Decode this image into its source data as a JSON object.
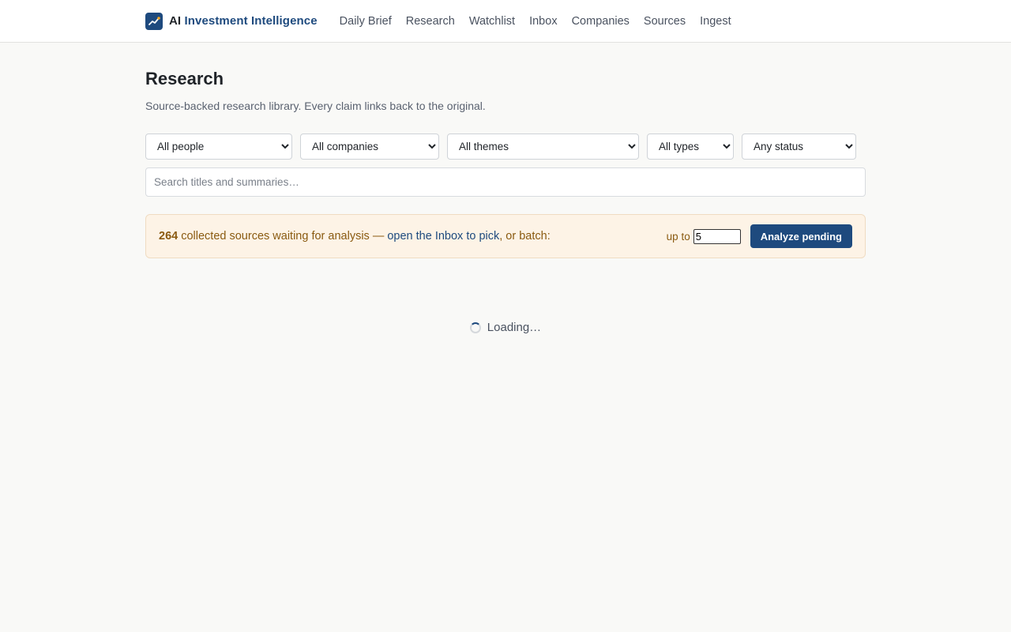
{
  "brand": {
    "prefix": "AI",
    "name": "Investment Intelligence",
    "logo_icon": "trend-chart-icon"
  },
  "nav": {
    "items": [
      {
        "label": "Daily Brief"
      },
      {
        "label": "Research"
      },
      {
        "label": "Watchlist"
      },
      {
        "label": "Inbox"
      },
      {
        "label": "Companies"
      },
      {
        "label": "Sources"
      },
      {
        "label": "Ingest"
      }
    ]
  },
  "page": {
    "title": "Research",
    "subtitle": "Source-backed research library. Every claim links back to the original."
  },
  "filters": {
    "people": "All people",
    "companies": "All companies",
    "themes": "All themes",
    "types": "All types",
    "status": "Any status"
  },
  "search": {
    "placeholder": "Search titles and summaries…"
  },
  "banner": {
    "count": "264",
    "text": " collected sources waiting for analysis — ",
    "link": "open the Inbox to pick",
    "suffix": ", or batch:",
    "upto_label": "up to",
    "upto_value": "5",
    "button_label": "Analyze pending"
  },
  "loading": {
    "text": "Loading…"
  },
  "colors": {
    "accent": "#1e4a7e",
    "banner_bg": "#fdf3e6",
    "banner_text": "#8a5a10",
    "page_bg": "#f9f9f7"
  }
}
